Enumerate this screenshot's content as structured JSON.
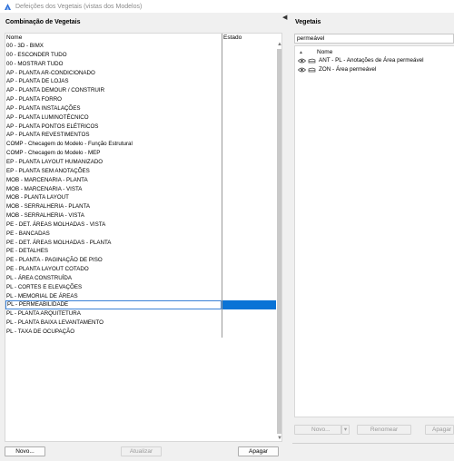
{
  "window": {
    "title": "Defeições dos Vegetais (vistas dos Modelos)"
  },
  "left": {
    "heading": "Combinação de Vegetais",
    "columns": {
      "name": "Nome",
      "estado": "Estado"
    },
    "rows": [
      "00 - 3D - BIMX",
      "00 - ESCONDER TUDO",
      "00 - MOSTRAR TUDO",
      "AP - PLANTA AR-CONDICIONADO",
      "AP - PLANTA DE LOJAS",
      "AP - PLANTA DEMOUR / CONSTRUIR",
      "AP - PLANTA FORRO",
      "AP - PLANTA INSTALAÇÕES",
      "AP - PLANTA LUMINOTÉCNICO",
      "AP - PLANTA PONTOS ELÉTRICOS",
      "AP - PLANTA REVESTIMENTOS",
      "COMP - Checagem do Modelo - Função Estrutural",
      "COMP - Checagem do Modelo - MEP",
      "EP - PLANTA LAYOUT HUMANIZADO",
      "EP - PLANTA SEM ANOTAÇÕES",
      "MOB - MARCENARIA - PLANTA",
      "MOB - MARCENARIA - VISTA",
      "MOB - PLANTA LAYOUT",
      "MOB - SERRALHERIA - PLANTA",
      "MOB - SERRALHERIA - VISTA",
      "PE - DET. ÁREAS MOLHADAS - VISTA",
      "PE - BANCADAS",
      "PE - DET. ÁREAS MOLHADAS - PLANTA",
      "PE - DETALHES",
      "PE - PLANTA - PAGINAÇÃO DE PISO",
      "PE - PLANTA LAYOUT COTADO",
      "PL - ÁREA CONSTRUÍDA",
      "PL - CORTES E ELEVAÇÕES",
      "PL - MEMORIAL DE ÁREAS",
      "PL - PERMEABILIDADE",
      "PL - PLANTA ARQUITETURA",
      "PL - PLANTA BAIXA LEVANTAMENTO",
      "PL - TAXA DE OCUPAÇÃO"
    ],
    "selected_row": "PL - PERMEABILIDADE",
    "buttons": {
      "new": "Novo...",
      "update": "Atualizar",
      "delete": "Apagar"
    }
  },
  "right": {
    "heading": "Vegetais",
    "search_value": "permeável",
    "column": "Nome",
    "rows": [
      {
        "text": "ANT - PL - Anotações de Área permeável",
        "visible": true
      },
      {
        "text": "ZON - Área permeável",
        "visible": true
      }
    ],
    "buttons": {
      "new": "Novo...",
      "rename": "Renomear",
      "delete": "Apagar"
    }
  },
  "colors": {
    "selection": "#0a73d6",
    "selection_border": "#3b82d6"
  }
}
